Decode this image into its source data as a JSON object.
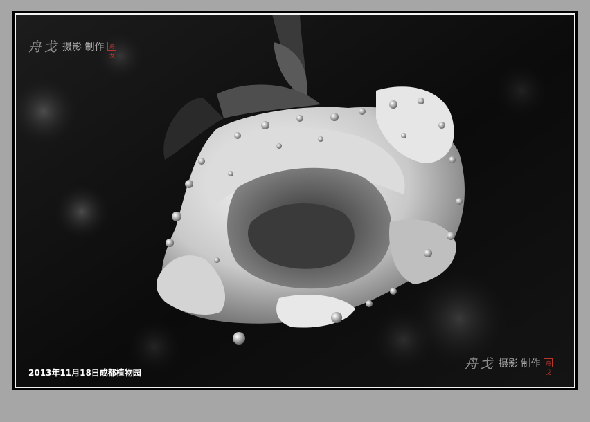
{
  "watermark": {
    "brush_text": "舟戈",
    "mid_text": "摄影 制作",
    "seal_text": "舟戈"
  },
  "caption": "2013年11月18日成都植物园",
  "colors": {
    "background": "#a6a6a6",
    "frame_dark": "#000000",
    "frame_line": "#f2f2f2",
    "seal_red": "#b8362e"
  }
}
